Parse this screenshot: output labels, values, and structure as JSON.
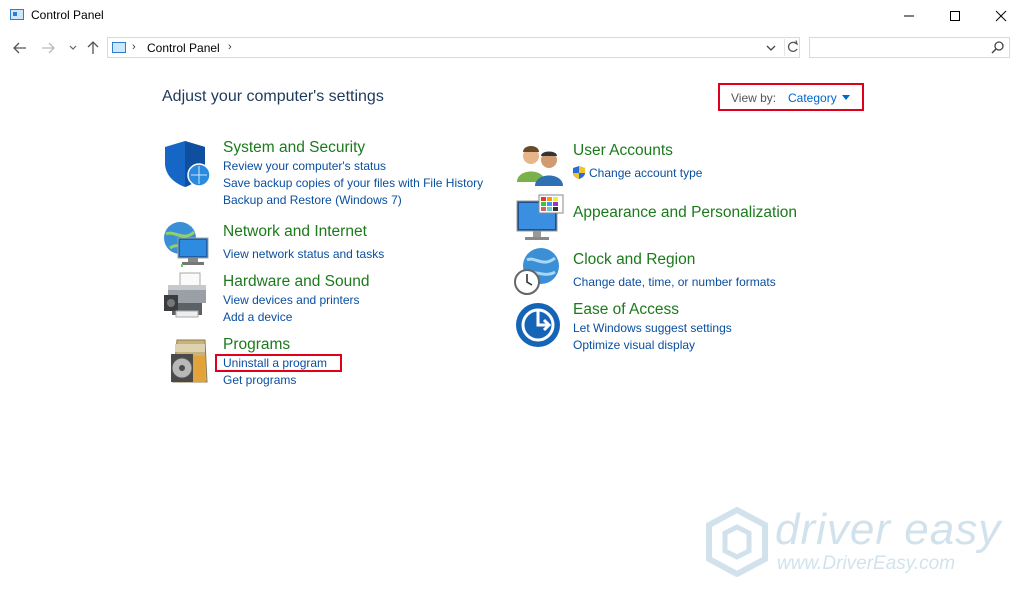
{
  "window": {
    "title": "Control Panel",
    "minimize_icon": "minimize-icon",
    "maximize_icon": "maximize-icon",
    "close_icon": "close-icon"
  },
  "address": {
    "crumbs": [
      "Control Panel"
    ],
    "search_placeholder": ""
  },
  "main": {
    "heading": "Adjust your computer's settings",
    "view_by_label": "View by:",
    "view_by_value": "Category"
  },
  "categories_left": [
    {
      "title": "System and Security",
      "icon": "shield-icon",
      "links": [
        "Review your computer's status",
        "Save backup copies of your files with File History",
        "Backup and Restore (Windows 7)"
      ]
    },
    {
      "title": "Network and Internet",
      "icon": "network-globe-icon",
      "links": [
        "View network status and tasks"
      ]
    },
    {
      "title": "Hardware and Sound",
      "icon": "printer-icon",
      "links": [
        "View devices and printers",
        "Add a device"
      ]
    },
    {
      "title": "Programs",
      "icon": "programs-disc-icon",
      "links": [
        "Uninstall a program",
        "Get programs"
      ]
    }
  ],
  "categories_right": [
    {
      "title": "User Accounts",
      "icon": "users-icon",
      "links": [
        "Change account type"
      ]
    },
    {
      "title": "Appearance and Personalization",
      "icon": "monitor-palette-icon",
      "links": []
    },
    {
      "title": "Clock and Region",
      "icon": "clock-globe-icon",
      "links": [
        "Change date, time, or number formats"
      ]
    },
    {
      "title": "Ease of Access",
      "icon": "ease-of-access-icon",
      "links": [
        "Let Windows suggest settings",
        "Optimize visual display"
      ]
    }
  ],
  "watermark": {
    "brand": "driver easy",
    "url": "www.DriverEasy.com"
  },
  "colors": {
    "category_title": "#1c7a1c",
    "link": "#0a4fa0",
    "highlight": "#e0001b"
  }
}
